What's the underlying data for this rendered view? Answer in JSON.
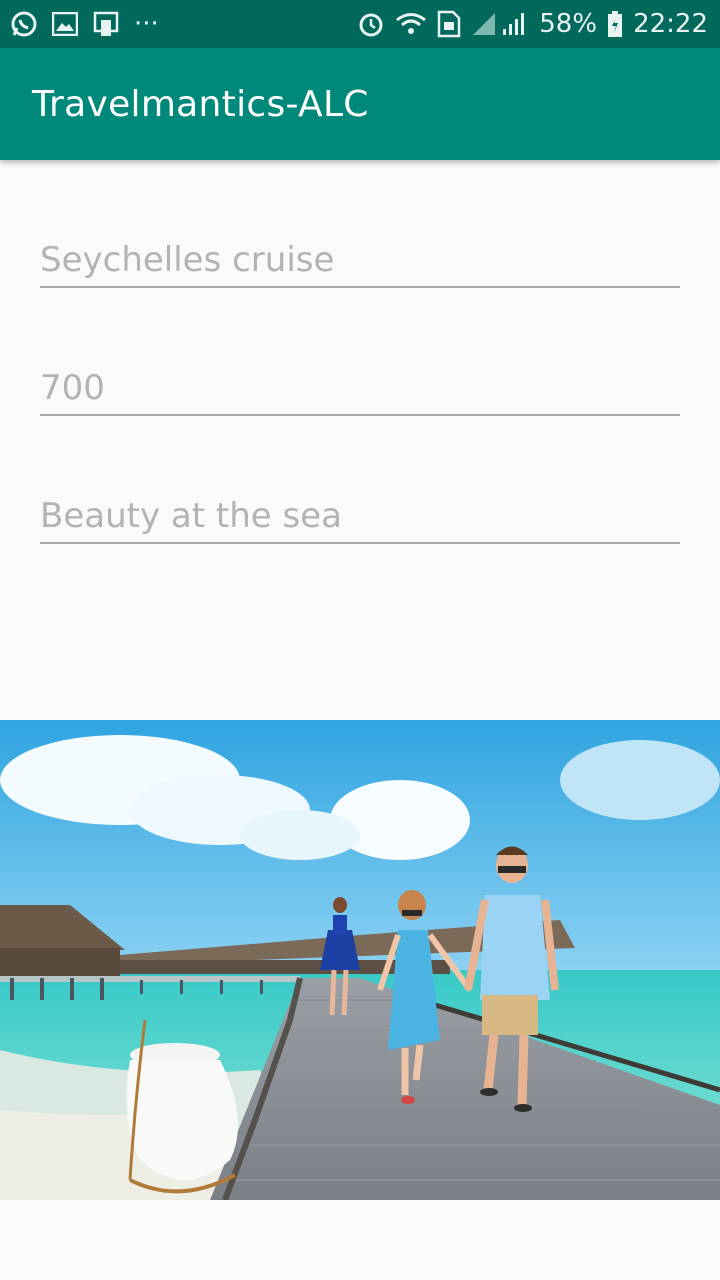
{
  "status_bar": {
    "left_icons": [
      "whatsapp-icon",
      "gallery-icon",
      "phone-screen-icon",
      "more-dots-icon"
    ],
    "battery_percent": "58%",
    "time": "22:22",
    "more_label": "···"
  },
  "app_bar": {
    "title": "Travelmantics-ALC"
  },
  "form": {
    "title_value": "Seychelles cruise",
    "price_value": "700",
    "description_value": "Beauty at the sea"
  },
  "image": {
    "icon": "beach-photo"
  }
}
